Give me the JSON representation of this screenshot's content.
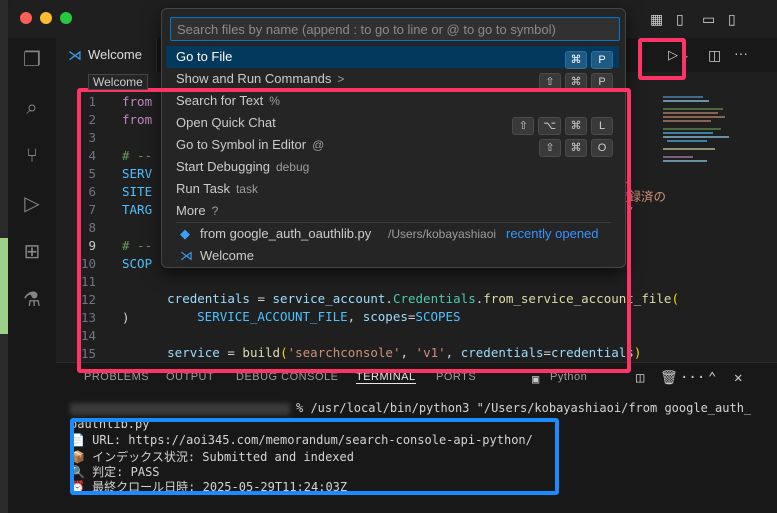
{
  "editor": {
    "tab_label": "Welcome",
    "tab_tooltip": "Welcome",
    "lines": [
      {
        "n": "1",
        "frag": "from"
      },
      {
        "n": "2",
        "frag": "from"
      },
      {
        "n": "3",
        "frag": ""
      },
      {
        "n": "4",
        "frag": "# --"
      },
      {
        "n": "5",
        "frag": "SERV"
      },
      {
        "n": "6",
        "frag": "SITE"
      },
      {
        "n": "7",
        "frag": "TARG"
      },
      {
        "n": "8",
        "frag": ""
      },
      {
        "n": "9",
        "frag": "# --"
      },
      {
        "n": "10",
        "frag": "SCOP"
      },
      {
        "n": "11",
        "frag": ""
      },
      {
        "n": "12",
        "frag": ""
      },
      {
        "n": "13",
        "frag": ")"
      },
      {
        "n": "14",
        "frag": ""
      },
      {
        "n": "15",
        "frag": ""
      }
    ],
    "line11": {
      "a": "credentials",
      "b": " = ",
      "c": "service_account",
      "d": ".",
      "e": "Credentials",
      "f": ".",
      "g": "from_service_account_file",
      "h": "("
    },
    "line12": {
      "a": "SERVICE_ACCOUNT_FILE",
      "b": ", ",
      "c": "scopes",
      "d": "=",
      "e": "SCOPES"
    },
    "line14": {
      "a": "service",
      "b": " = ",
      "c": "build",
      "d": "(",
      "e": "'searchconsole'",
      "f": ", ",
      "g": "'v1'",
      "h": ", ",
      "i": "credentials",
      "j": "=",
      "k": "credentials",
      "l": ")"
    },
    "right_fragment_5": "ス",
    "right_fragment_6": "登録済の",
    "right_fragment_7": "/"
  },
  "quick_pick": {
    "placeholder": "Search files by name (append : to go to line or @ to go to symbol)",
    "items": [
      {
        "label": "Go to File",
        "hint": "",
        "keys": [
          "⌘",
          "P"
        ]
      },
      {
        "label": "Show and Run Commands",
        "hint": ">",
        "keys": [
          "⇧",
          "⌘",
          "P"
        ]
      },
      {
        "label": "Search for Text",
        "hint": "%",
        "keys": []
      },
      {
        "label": "Open Quick Chat",
        "hint": "",
        "keys": [
          "⇧",
          "⌥",
          "⌘",
          "L"
        ]
      },
      {
        "label": "Go to Symbol in Editor",
        "hint": "@",
        "keys": [
          "⇧",
          "⌘",
          "O"
        ]
      },
      {
        "label": "Start Debugging",
        "hint": "debug",
        "keys": []
      },
      {
        "label": "Run Task",
        "hint": "task",
        "keys": []
      },
      {
        "label": "More",
        "hint": "?",
        "keys": []
      }
    ],
    "recent": [
      {
        "label": "from google_auth_oauthlib.py",
        "path": "/Users/kobayashiaoi",
        "badge": "recently opened"
      },
      {
        "label": "Welcome"
      }
    ]
  },
  "panel": {
    "tabs": [
      "PROBLEMS",
      "OUTPUT",
      "DEBUG CONSOLE",
      "TERMINAL",
      "PORTS"
    ],
    "terminal_label": "Python",
    "terminal": {
      "cmd": "% /usr/local/bin/python3 \"/Users/kobayashiaoi/from google_auth_",
      "cont": "oauthlib.py",
      "out": [
        {
          "icon": "📄",
          "text": " URL: https://aoi345.com/memorandum/search-console-api-python/"
        },
        {
          "icon": "📦",
          "text": " インデックス状況: Submitted and indexed"
        },
        {
          "icon": "🔍",
          "text": " 判定: PASS"
        },
        {
          "icon": "⏰",
          "text": " 最終クロール日時: 2025-05-29T11:24:03Z"
        }
      ]
    }
  },
  "colors": {
    "accent": "#0078d4",
    "annotation_red": "#ff3366",
    "annotation_blue": "#1a8cff"
  },
  "icons": [
    "explorer-icon",
    "search-icon",
    "source-control-icon",
    "run-debug-icon",
    "extensions-icon",
    "testing-icon",
    "run-icon",
    "split-editor-icon",
    "more-icon",
    "layout-icon",
    "trash-icon",
    "close-icon",
    "chevron-up-icon",
    "python-file-icon",
    "vscode-icon"
  ]
}
